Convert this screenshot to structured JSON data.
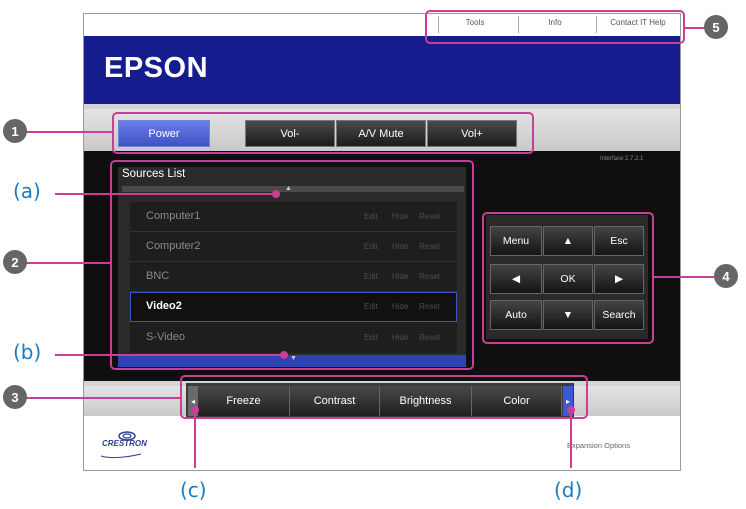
{
  "top_links": [
    "Tools",
    "Info",
    "Contact IT Help"
  ],
  "brand": "EPSON",
  "control": {
    "power": "Power",
    "vol_down": "Vol-",
    "av_mute": "A/V Mute",
    "vol_up": "Vol+"
  },
  "interface_version": "Interface 2.7.2.1",
  "sources": {
    "title": "Sources List",
    "scroll_up": "▲",
    "scroll_down": "▼",
    "actions": [
      "Edit",
      "Hide",
      "Reset"
    ],
    "items": [
      "Computer1",
      "Computer2",
      "BNC",
      "Video2",
      "S-Video"
    ],
    "selected": "Video2"
  },
  "dpad": {
    "menu": "Menu",
    "up": "▲",
    "esc": "Esc",
    "left": "◀",
    "ok": "OK",
    "right": "▶",
    "auto": "Auto",
    "down": "▼",
    "search": "Search"
  },
  "adjust": {
    "prev": "◂",
    "freeze": "Freeze",
    "contrast": "Contrast",
    "brightness": "Brightness",
    "color": "Color",
    "next": "▸"
  },
  "crestron": "CRESTRON",
  "expansion": "Expansion Options",
  "callouts": {
    "n1": "1",
    "n2": "2",
    "n3": "3",
    "n4": "4",
    "n5": "5",
    "a": "(a)",
    "b": "(b)",
    "c": "(c)",
    "d": "(d)"
  },
  "colors": {
    "header": "#151d8e",
    "callout": "#c93f95",
    "selected_border": "#3a55c8",
    "power": "#4f62d4",
    "letter": "#1a7dc2"
  }
}
